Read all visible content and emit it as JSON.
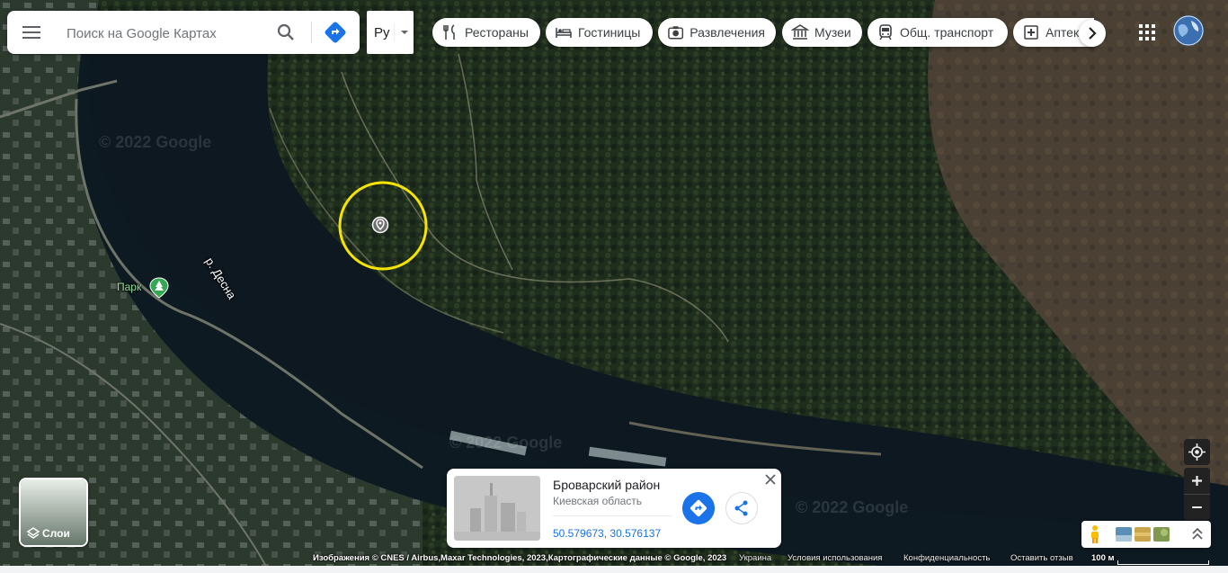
{
  "search": {
    "placeholder": "Поиск на Google Картах",
    "menu_icon": "menu-icon",
    "search_icon": "search-icon",
    "directions_icon": "directions-icon"
  },
  "language": {
    "label": "Ру"
  },
  "categories": [
    {
      "label": "Рестораны",
      "icon": "restaurant-icon"
    },
    {
      "label": "Гостиницы",
      "icon": "hotel-icon"
    },
    {
      "label": "Развлечения",
      "icon": "camera-icon"
    },
    {
      "label": "Музеи",
      "icon": "museum-icon"
    },
    {
      "label": "Общ. транспорт",
      "icon": "transit-icon"
    },
    {
      "label": "Аптек",
      "icon": "pharmacy-icon"
    }
  ],
  "map": {
    "river_label": "р. Десна",
    "park_label": "Парк",
    "watermark": "© 2022 Google"
  },
  "layers": {
    "label": "Слои"
  },
  "info_card": {
    "title": "Броварский район",
    "subtitle": "Киевская область",
    "coords": "50.579673, 30.576137"
  },
  "footer": {
    "imagery": "Изображения © CNES / Airbus,Maxar Technologies, 2023,Картографические данные © Google, 2023",
    "country": "Украина",
    "terms": "Условия использования",
    "privacy": "Конфиденциальность",
    "feedback": "Оставить отзыв",
    "scale": "100 м"
  },
  "colors": {
    "highlight_circle": "#f5e400",
    "accent_blue": "#1a73e8",
    "park_green": "#34a853"
  }
}
